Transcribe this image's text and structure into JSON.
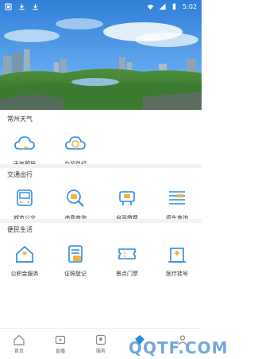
{
  "status_bar": {
    "time": "5:02"
  },
  "sections": [
    {
      "title": "常州天气",
      "items": [
        {
          "label": "天气预报",
          "icon": "weather-cloud-icon"
        },
        {
          "label": "台风路径",
          "icon": "typhoon-path-icon"
        }
      ]
    },
    {
      "title": "交通出行",
      "items": [
        {
          "label": "城市公交",
          "icon": "bus-icon"
        },
        {
          "label": "违章查询",
          "icon": "violation-search-icon"
        },
        {
          "label": "自驾缴费",
          "icon": "car-payment-icon"
        },
        {
          "label": "停车查询",
          "icon": "parking-search-icon"
        }
      ]
    },
    {
      "title": "便民生活",
      "items": [
        {
          "label": "公积金服务",
          "icon": "house-fund-icon"
        },
        {
          "label": "证照登记",
          "icon": "license-register-icon"
        },
        {
          "label": "景点门票",
          "icon": "ticket-icon"
        },
        {
          "label": "医疗挂号",
          "icon": "hospital-icon"
        }
      ]
    }
  ],
  "bottom_nav": [
    {
      "label": "首页",
      "icon": "home-icon"
    },
    {
      "label": "直播",
      "icon": "live-video-icon"
    },
    {
      "label": "服务",
      "icon": "service-icon"
    },
    {
      "label": "",
      "icon": "center-icon"
    },
    {
      "label": "",
      "icon": "profile-icon"
    }
  ],
  "watermark": "QQTF.COM",
  "colors": {
    "accent": "#2b8ae0",
    "icon_yellow": "#f2b63c"
  }
}
